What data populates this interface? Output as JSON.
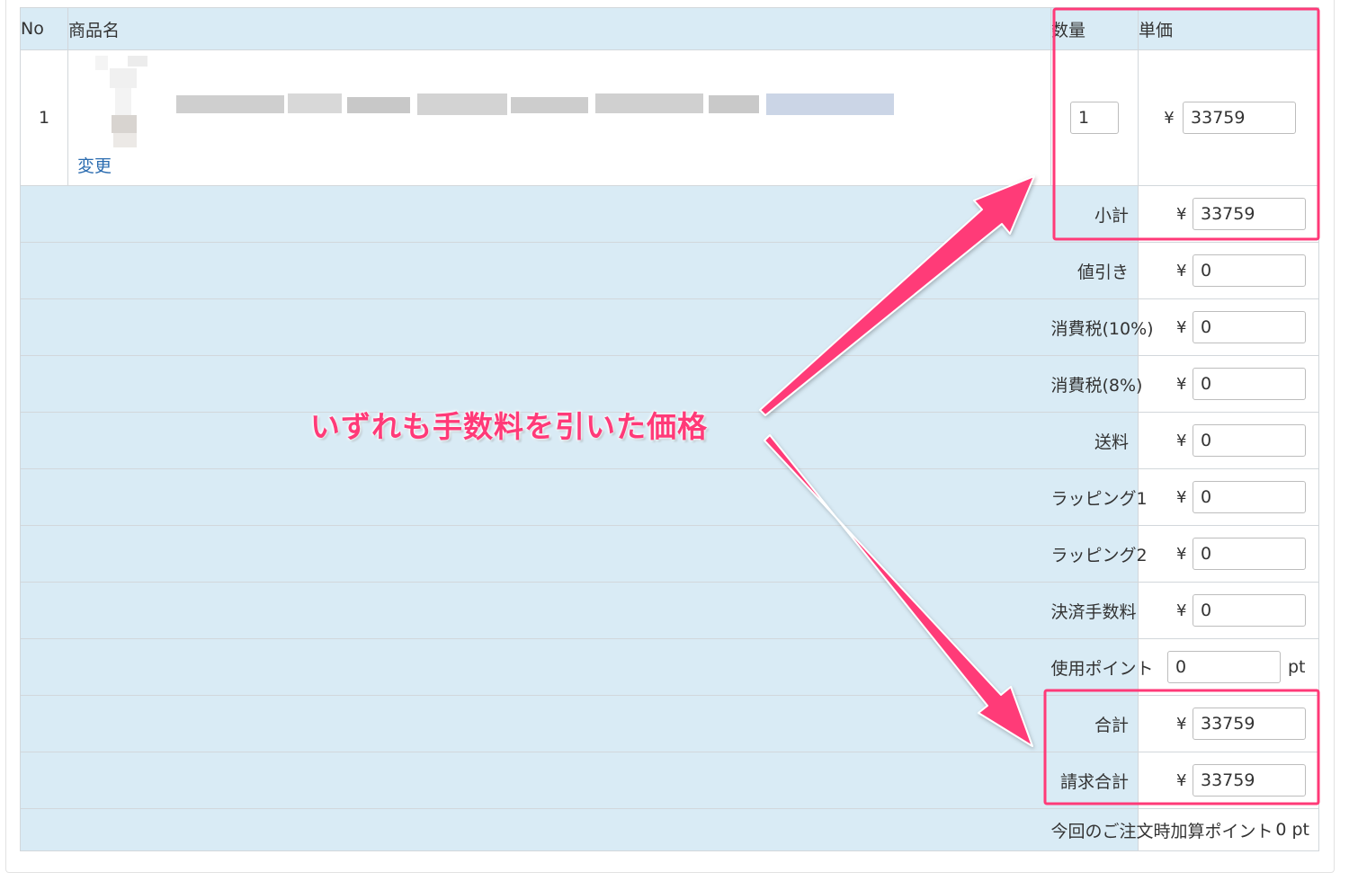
{
  "table": {
    "headers": {
      "no": "No",
      "name": "商品名",
      "qty": "数量",
      "price": "単価"
    },
    "item": {
      "no": "1",
      "change_link": "変更",
      "quantity": "1",
      "unit_price": "33759"
    },
    "currency": "¥",
    "summary": [
      {
        "key": "subtotal",
        "label": "小計",
        "value": "33759"
      },
      {
        "key": "discount",
        "label": "値引き",
        "value": "0"
      },
      {
        "key": "tax10",
        "label": "消費税(10%)",
        "value": "0"
      },
      {
        "key": "tax8",
        "label": "消費税(8%)",
        "value": "0"
      },
      {
        "key": "shipping",
        "label": "送料",
        "value": "0"
      },
      {
        "key": "wrapping1",
        "label": "ラッピング1",
        "value": "0"
      },
      {
        "key": "wrapping2",
        "label": "ラッピング2",
        "value": "0"
      },
      {
        "key": "payment_fee",
        "label": "決済手数料",
        "value": "0"
      },
      {
        "key": "use_point",
        "label": "使用ポイント",
        "value": "0",
        "unit": "pt"
      },
      {
        "key": "total",
        "label": "合計",
        "value": "33759"
      },
      {
        "key": "billing_total",
        "label": "請求合計",
        "value": "33759"
      }
    ],
    "earned_points": {
      "label": "今回のご注文時加算ポイント",
      "value": "0 pt"
    }
  },
  "annotation": {
    "text": "いずれも手数料を引いた価格",
    "color": "#ff3a78"
  },
  "colors": {
    "header_bg": "#d9ebf5",
    "highlight": "#ff3a78",
    "link": "#2b6cb0"
  }
}
